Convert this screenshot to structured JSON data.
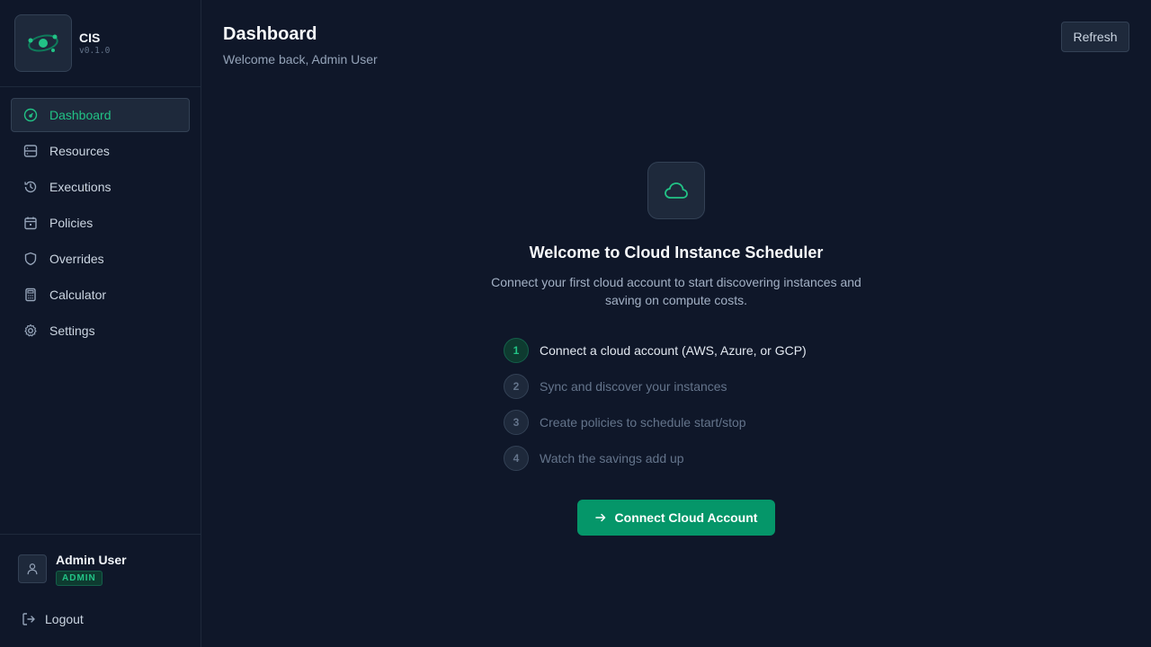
{
  "brand": {
    "name": "CIS",
    "version": "v0.1.0",
    "logo_icon": "orbit-logo-icon"
  },
  "sidebar": {
    "items": [
      {
        "label": "Dashboard",
        "icon": "gauge-icon",
        "active": true
      },
      {
        "label": "Resources",
        "icon": "server-icon",
        "active": false
      },
      {
        "label": "Executions",
        "icon": "history-icon",
        "active": false
      },
      {
        "label": "Policies",
        "icon": "calendar-icon",
        "active": false
      },
      {
        "label": "Overrides",
        "icon": "shield-icon",
        "active": false
      },
      {
        "label": "Calculator",
        "icon": "calculator-icon",
        "active": false
      },
      {
        "label": "Settings",
        "icon": "gear-icon",
        "active": false
      }
    ]
  },
  "user": {
    "name": "Admin User",
    "role": "ADMIN",
    "logout_label": "Logout"
  },
  "header": {
    "title": "Dashboard",
    "subtitle": "Welcome back, Admin User",
    "refresh_label": "Refresh"
  },
  "welcome": {
    "icon": "cloud-icon",
    "title": "Welcome to Cloud Instance Scheduler",
    "description_line1": "Connect your first cloud account to start discovering instances and",
    "description_line2": "saving on compute costs.",
    "steps": [
      {
        "number": "1",
        "label": "Connect a cloud account (AWS, Azure, or GCP)",
        "active": true
      },
      {
        "number": "2",
        "label": "Sync and discover your instances",
        "active": false
      },
      {
        "number": "3",
        "label": "Create policies to schedule start/stop",
        "active": false
      },
      {
        "number": "4",
        "label": "Watch the savings add up",
        "active": false
      }
    ],
    "cta_label": "Connect Cloud Account"
  },
  "colors": {
    "accent": "#22c386",
    "button": "#059669",
    "background": "#0f1729",
    "panel": "#1e293b"
  }
}
